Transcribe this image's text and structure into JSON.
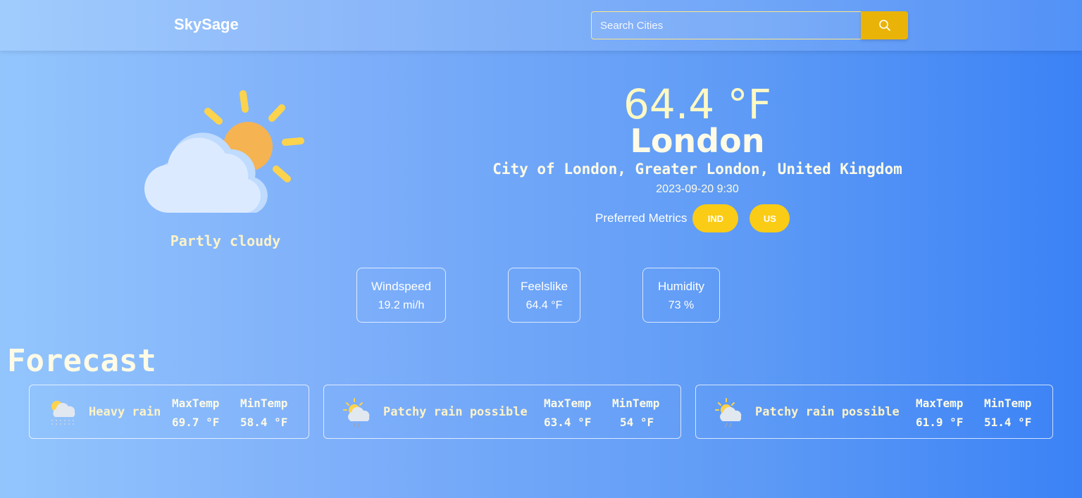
{
  "nav": {
    "brand": "SkySage",
    "search_placeholder": "Search Cities"
  },
  "current": {
    "temperature": "64.4 °F",
    "city": "London",
    "region": "City of London, Greater London, United Kingdom",
    "datetime": "2023-09-20 9:30",
    "condition": "Partly cloudy",
    "icon": "partly-cloudy-icon"
  },
  "metrics": {
    "label": "Preferred Metrics",
    "options": [
      "IND",
      "US"
    ]
  },
  "stats": [
    {
      "title": "Windspeed",
      "value": "19.2 mi/h"
    },
    {
      "title": "Feelslike",
      "value": "64.4 °F"
    },
    {
      "title": "Humidity",
      "value": "73 %"
    }
  ],
  "forecast": {
    "title": "Forecast",
    "max_label": "MaxTemp",
    "min_label": "MinTemp",
    "days": [
      {
        "condition": "Heavy rain",
        "max": "69.7 °F",
        "min": "58.4 °F",
        "icon": "heavy-rain-icon"
      },
      {
        "condition": "Patchy rain possible",
        "max": "63.4 °F",
        "min": "54 °F",
        "icon": "patchy-rain-icon"
      },
      {
        "condition": "Patchy rain possible",
        "max": "61.9 °F",
        "min": "51.4 °F",
        "icon": "patchy-rain-icon"
      }
    ]
  },
  "colors": {
    "accent": "#facc15",
    "search_button": "#eab308",
    "gradient_start": "#93c5fd",
    "gradient_end": "#3b82f6"
  }
}
